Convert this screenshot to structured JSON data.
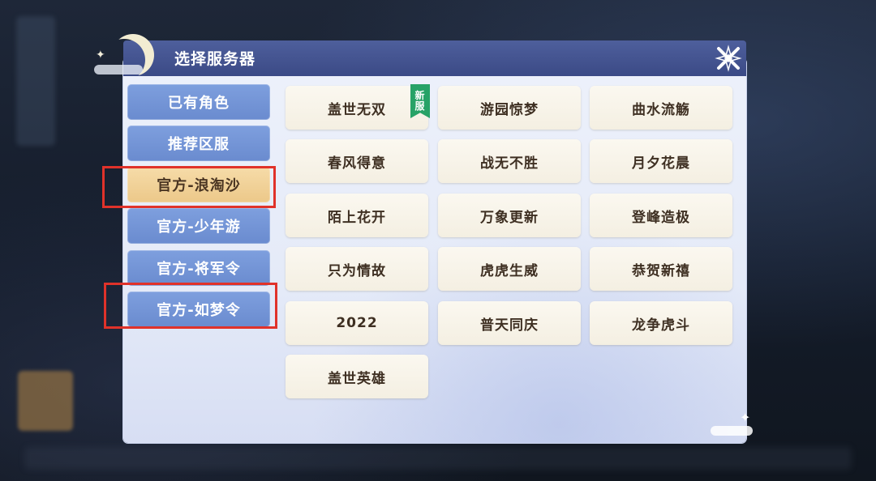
{
  "dialog": {
    "title": "选择服务器"
  },
  "sidebar": {
    "items": [
      {
        "label": "已有角色",
        "active": false
      },
      {
        "label": "推荐区服",
        "active": false
      },
      {
        "label": "官方-浪淘沙",
        "active": true
      },
      {
        "label": "官方-少年游",
        "active": false
      },
      {
        "label": "官方-将军令",
        "active": false
      },
      {
        "label": "官方-如梦令",
        "active": false
      }
    ]
  },
  "servers": [
    {
      "label": "盖世无双",
      "badge": "新服"
    },
    {
      "label": "游园惊梦"
    },
    {
      "label": "曲水流觞"
    },
    {
      "label": "春风得意"
    },
    {
      "label": "战无不胜"
    },
    {
      "label": "月夕花晨"
    },
    {
      "label": "陌上花开"
    },
    {
      "label": "万象更新"
    },
    {
      "label": "登峰造极"
    },
    {
      "label": "只为情故"
    },
    {
      "label": "虎虎生威"
    },
    {
      "label": "恭贺新禧"
    },
    {
      "label": "2022"
    },
    {
      "label": "普天同庆"
    },
    {
      "label": "龙争虎斗"
    },
    {
      "label": "盖世英雄"
    }
  ],
  "badge_chars": [
    "新",
    "服"
  ],
  "colors": {
    "header": "#3b4a86",
    "sidebar_button": "#6a8bcf",
    "sidebar_active": "#ecc889",
    "highlight_box": "#e0322a",
    "new_badge": "#27a267"
  }
}
